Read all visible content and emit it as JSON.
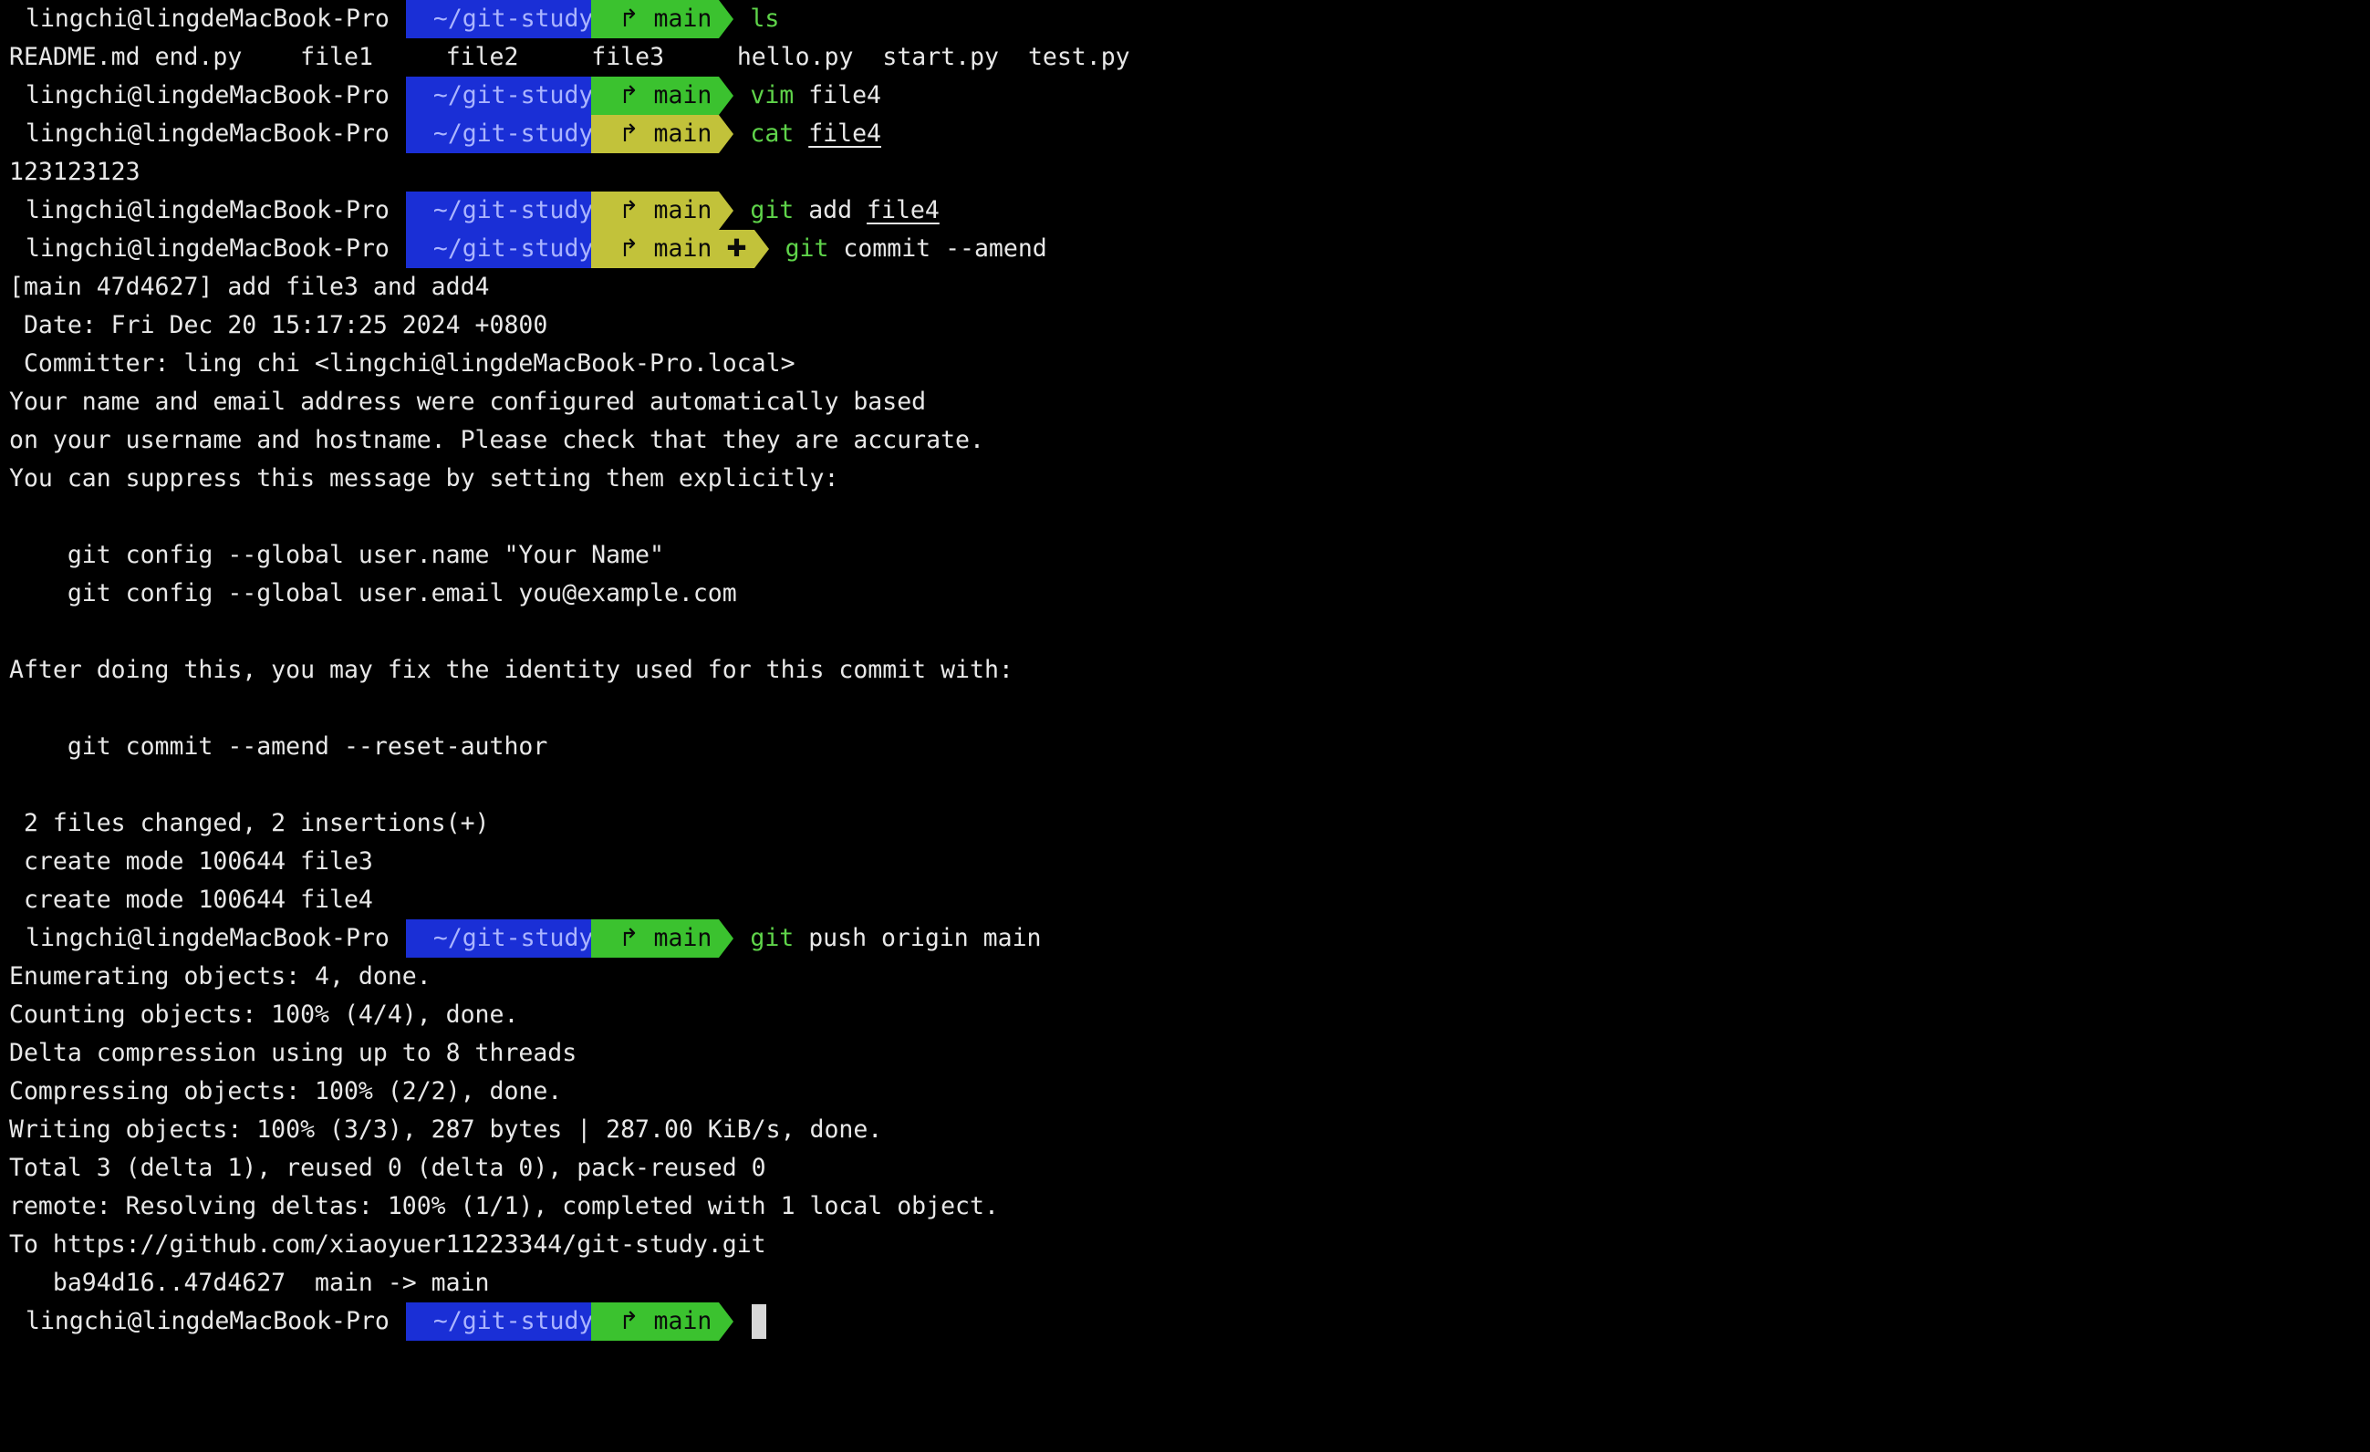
{
  "prompt": {
    "user": "lingchi@lingdeMacBook-Pro",
    "dir": "~/git-study",
    "branch": "main",
    "branch_icon": "↱",
    "staged_marker": "✚"
  },
  "colors": {
    "background": "#000000",
    "dir_segment": "#1a2fd6",
    "git_clean_segment": "#3bc22f",
    "git_dirty_segment": "#c2c23a",
    "command_green": "#5fd44a"
  },
  "commands": {
    "c1": {
      "kw": "ls",
      "rest": ""
    },
    "c2": {
      "kw": "vim",
      "rest": " file4"
    },
    "c3": {
      "kw": "cat",
      "rest": "file4"
    },
    "c4": {
      "kw": "git",
      "rest1": " add ",
      "rest2": "file4"
    },
    "c5": {
      "kw": "git",
      "rest": " commit --amend"
    },
    "c6": {
      "kw": "git",
      "rest": " push origin main"
    }
  },
  "ls_files": [
    "README.md",
    "end.py",
    "file1",
    "file2",
    "file3",
    "hello.py",
    "start.py",
    "test.py"
  ],
  "output": {
    "cat": "123123123",
    "commit": [
      "[main 47d4627] add file3 and add4",
      " Date: Fri Dec 20 15:17:25 2024 +0800",
      " Committer: ling chi <lingchi@lingdeMacBook-Pro.local>",
      "Your name and email address were configured automatically based",
      "on your username and hostname. Please check that they are accurate.",
      "You can suppress this message by setting them explicitly:",
      "",
      "    git config --global user.name \"Your Name\"",
      "    git config --global user.email you@example.com",
      "",
      "After doing this, you may fix the identity used for this commit with:",
      "",
      "    git commit --amend --reset-author",
      "",
      " 2 files changed, 2 insertions(+)",
      " create mode 100644 file3",
      " create mode 100644 file4"
    ],
    "push": [
      "Enumerating objects: 4, done.",
      "Counting objects: 100% (4/4), done.",
      "Delta compression using up to 8 threads",
      "Compressing objects: 100% (2/2), done.",
      "Writing objects: 100% (3/3), 287 bytes | 287.00 KiB/s, done.",
      "Total 3 (delta 1), reused 0 (delta 0), pack-reused 0",
      "remote: Resolving deltas: 100% (1/1), completed with 1 local object.",
      "To https://github.com/xiaoyuer11223344/git-study.git",
      "   ba94d16..47d4627  main -> main"
    ]
  }
}
